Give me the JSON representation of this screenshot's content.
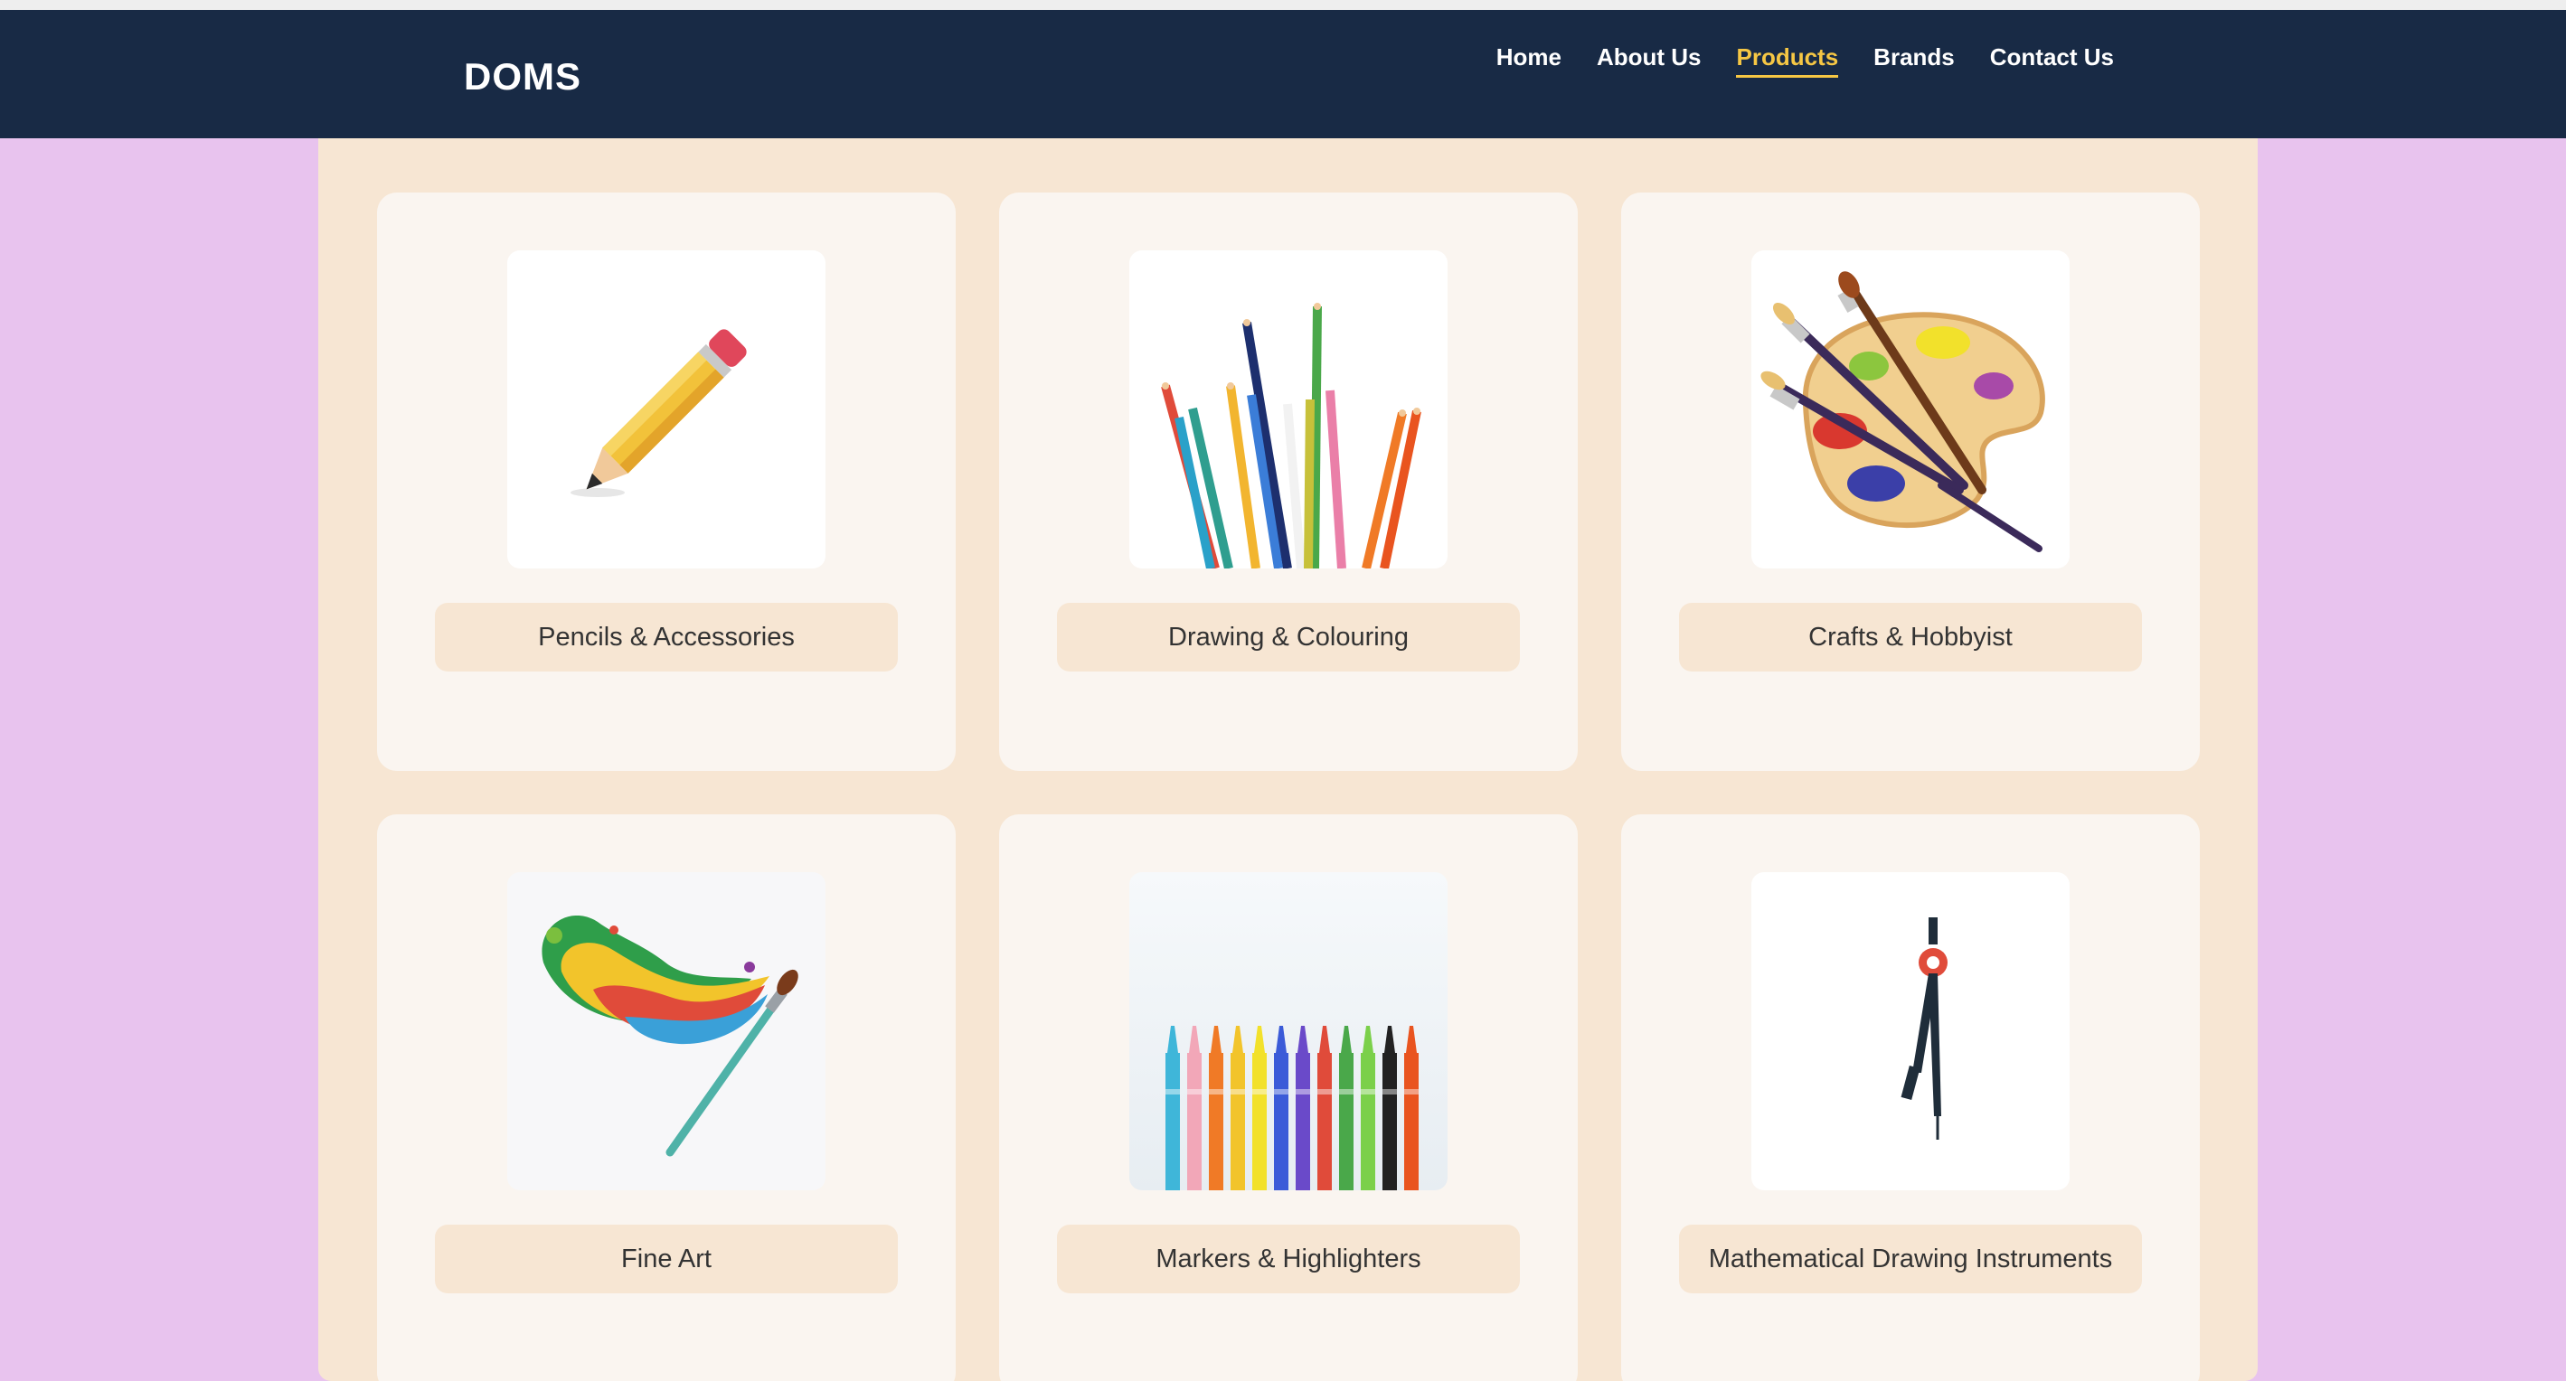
{
  "brand": "DOMS",
  "nav": {
    "items": [
      {
        "label": "Home",
        "active": false
      },
      {
        "label": "About Us",
        "active": false
      },
      {
        "label": "Products",
        "active": true
      },
      {
        "label": "Brands",
        "active": false
      },
      {
        "label": "Contact Us",
        "active": false
      }
    ]
  },
  "colors": {
    "page_bg": "#e8c3ee",
    "navbar_bg": "#182a45",
    "nav_active": "#f6c744",
    "panel_bg": "#f7e6d3",
    "card_bg": "#faf5f0"
  },
  "products": [
    {
      "label": "Pencils & Accessories",
      "icon": "pencil-icon"
    },
    {
      "label": "Drawing & Colouring",
      "icon": "colour-pencils-icon"
    },
    {
      "label": "Crafts & Hobbyist",
      "icon": "paint-palette-icon"
    },
    {
      "label": "Fine Art",
      "icon": "paint-brush-splash-icon"
    },
    {
      "label": "Markers & Highlighters",
      "icon": "markers-icon"
    },
    {
      "label": "Mathematical Drawing Instruments",
      "icon": "compass-icon"
    }
  ]
}
